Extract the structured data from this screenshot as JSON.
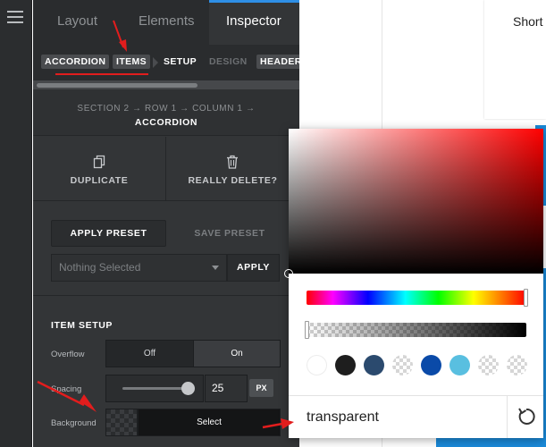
{
  "tabs": [
    {
      "label": "Layout"
    },
    {
      "label": "Elements"
    },
    {
      "label": "Inspector"
    }
  ],
  "breadcrumb": {
    "accordion": "ACCORDION",
    "items": "ITEMS",
    "setup": "SETUP",
    "design": "DESIGN",
    "header": "HEADER"
  },
  "path": {
    "line1": "SECTION 2 → ROW 1 → COLUMN 1 →",
    "line2": "ACCORDION"
  },
  "actions": {
    "duplicate": "DUPLICATE",
    "delete": "REALLY DELETE?"
  },
  "preset": {
    "apply_preset": "APPLY PRESET",
    "save_preset": "SAVE PRESET",
    "select_placeholder": "Nothing Selected",
    "apply": "APPLY"
  },
  "item_setup": {
    "title": "ITEM SETUP",
    "overflow_label": "Overflow",
    "overflow_off": "Off",
    "overflow_on": "On",
    "spacing_label": "Spacing",
    "spacing_value": "25",
    "spacing_unit": "PX",
    "spacing_fraction": 0.9,
    "background_label": "Background",
    "background_select": "Select"
  },
  "canvas": {
    "card_title": "Short"
  },
  "color_picker": {
    "hex_value": "transparent",
    "hue_position": 1.0,
    "alpha_position": 0.0,
    "swatches": [
      "transparent",
      "#1e1e1e",
      "#2b4a6e",
      "transparent",
      "#0a4aa8",
      "#59bfe0",
      "transparent",
      "transparent"
    ]
  },
  "colors": {
    "accent_blue": "#2e8fe6",
    "annotation_red": "#e21d1d",
    "panel_bg": "#333537"
  }
}
